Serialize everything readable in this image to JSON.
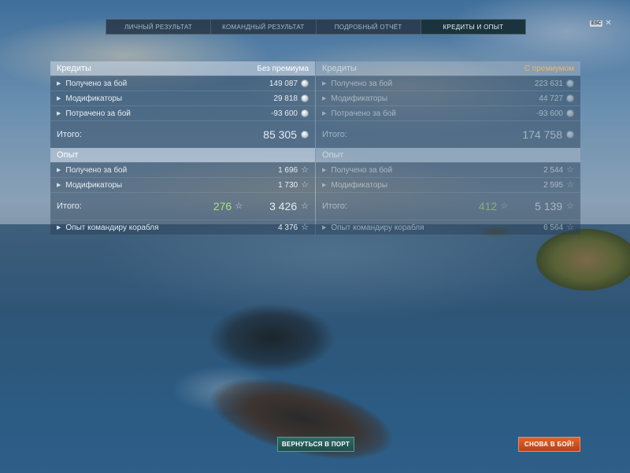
{
  "tabs": [
    {
      "label": "ЛИЧНЫЙ РЕЗУЛЬТАТ",
      "active": false
    },
    {
      "label": "КОМАНДНЫЙ РЕЗУЛЬТАТ",
      "active": false
    },
    {
      "label": "ПОДРОБНЫЙ ОТЧЁТ",
      "active": false
    },
    {
      "label": "КРЕДИТЫ И ОПЫТ",
      "active": true
    }
  ],
  "esc": {
    "badge": "ESC",
    "close": "✕"
  },
  "left": {
    "credits": {
      "title": "Кредиты",
      "subtitle": "Без премиума",
      "rows": [
        {
          "label": "Получено за бой",
          "value": "149 087"
        },
        {
          "label": "Модификаторы",
          "value": "29 818"
        },
        {
          "label": "Потрачено за бой",
          "value": "-93 600"
        }
      ],
      "total_label": "Итого:",
      "total_value": "85 305"
    },
    "xp": {
      "title": "Опыт",
      "rows": [
        {
          "label": "Получено за бой",
          "value": "1 696"
        },
        {
          "label": "Модификаторы",
          "value": "1 730"
        }
      ],
      "total_label": "Итого:",
      "free_value": "276",
      "total_value": "3 426",
      "commander_label": "Опыт командиру корабля",
      "commander_value": "4 376"
    }
  },
  "right": {
    "credits": {
      "title": "Кредиты",
      "subtitle": "С премиумом",
      "rows": [
        {
          "label": "Получено за бой",
          "value": "223 631"
        },
        {
          "label": "Модификаторы",
          "value": "44 727"
        },
        {
          "label": "Потрачено за бой",
          "value": "-93 600"
        }
      ],
      "total_label": "Итого:",
      "total_value": "174 758"
    },
    "xp": {
      "title": "Опыт",
      "rows": [
        {
          "label": "Получено за бой",
          "value": "2 544"
        },
        {
          "label": "Модификаторы",
          "value": "2 595"
        }
      ],
      "total_label": "Итого:",
      "free_value": "412",
      "total_value": "5 139",
      "commander_label": "Опыт командиру корабля",
      "commander_value": "6 564"
    }
  },
  "buttons": {
    "return_port": "ВЕРНУТЬСЯ В ПОРТ",
    "battle_again": "СНОВА В БОЙ!"
  },
  "colors": {
    "premium_accent": "#f0b46a",
    "free_xp": "#a8e07a",
    "battle_button": "#d9582a",
    "port_button": "#2a605c"
  }
}
